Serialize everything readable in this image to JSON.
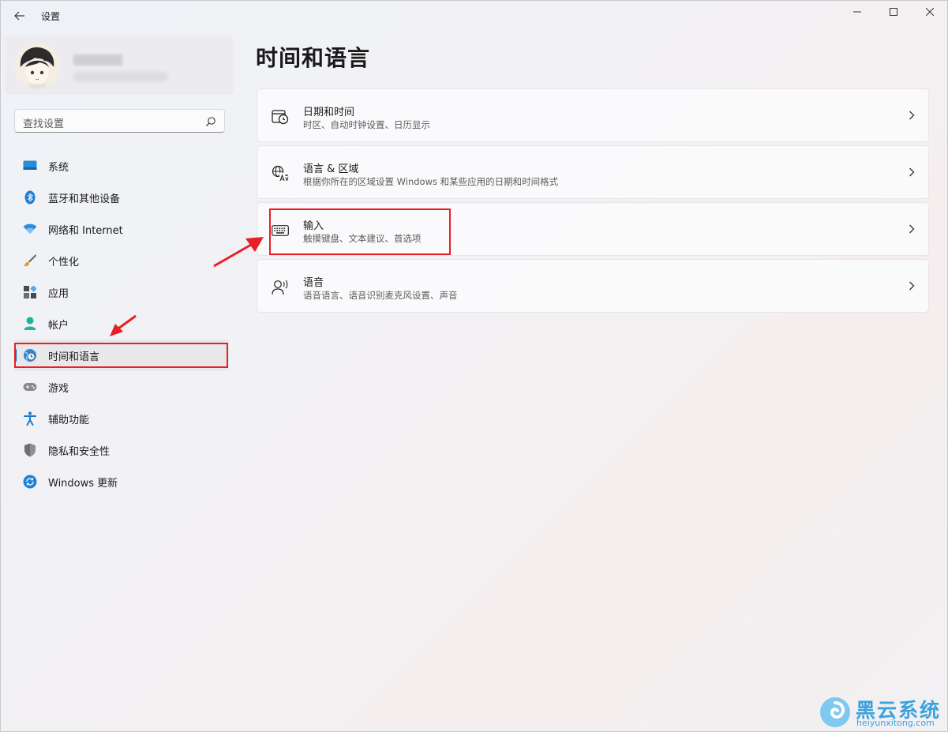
{
  "window": {
    "title": "设置"
  },
  "sidebar": {
    "search_placeholder": "查找设置",
    "items": [
      {
        "label": "系统",
        "icon": "monitor-icon"
      },
      {
        "label": "蓝牙和其他设备",
        "icon": "bluetooth-icon"
      },
      {
        "label": "网络和 Internet",
        "icon": "wifi-icon"
      },
      {
        "label": "个性化",
        "icon": "brush-icon"
      },
      {
        "label": "应用",
        "icon": "apps-icon"
      },
      {
        "label": "帐户",
        "icon": "account-icon"
      },
      {
        "label": "时间和语言",
        "icon": "globe-clock-icon",
        "active": true
      },
      {
        "label": "游戏",
        "icon": "gamepad-icon"
      },
      {
        "label": "辅助功能",
        "icon": "accessibility-icon"
      },
      {
        "label": "隐私和安全性",
        "icon": "shield-icon"
      },
      {
        "label": "Windows 更新",
        "icon": "update-icon"
      }
    ]
  },
  "main": {
    "title": "时间和语言",
    "cards": [
      {
        "title": "日期和时间",
        "desc": "时区、自动时钟设置、日历显示",
        "icon": "calendar-clock-icon"
      },
      {
        "title": "语言 & 区域",
        "desc": "根据你所在的区域设置 Windows 和某些应用的日期和时间格式",
        "icon": "language-icon"
      },
      {
        "title": "输入",
        "desc": "触摸键盘、文本建议、首选项",
        "icon": "keyboard-icon"
      },
      {
        "title": "语音",
        "desc": "语音语言、语音识别麦克风设置、声音",
        "icon": "speech-icon"
      }
    ]
  },
  "watermark": {
    "name": "黑云系统",
    "url": "heiyunxitong.com"
  },
  "colors": {
    "accent": "#0067c0",
    "annotation": "#e81f25",
    "watermark": "#3aa3de"
  }
}
